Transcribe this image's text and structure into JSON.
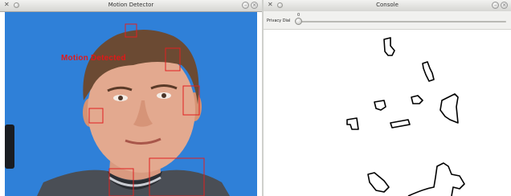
{
  "left_window": {
    "title": "Motion Detector",
    "overlay_text": "Motion Detected"
  },
  "right_window": {
    "title": "Console",
    "privacy_dial": {
      "label": "Privacy Dial",
      "value": "0"
    }
  },
  "colors": {
    "video_background": "#2f80d8",
    "detection_box": "#e02020",
    "overlay_text": "#e01818",
    "contour": "#000000"
  }
}
